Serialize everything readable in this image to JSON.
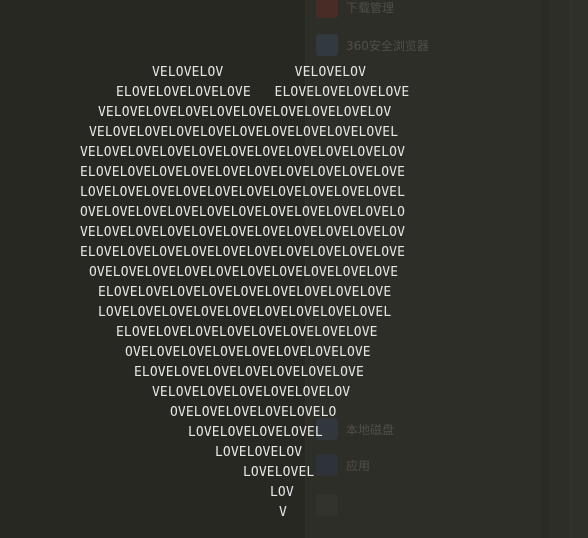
{
  "terminal": {
    "top_fragment": "  ''        '' ",
    "heart_lines": [
      "VELOVELOV         VELOVELOV",
      "ELOVELOVELOVELOVE   ELOVELOVELOVELOVE",
      "VELOVELOVELOVELOVELOVELOVELOVELOVELOV",
      "VELOVELOVELOVELOVELOVELOVELOVELOVELOVEL",
      "VELOVELOVELOVELOVELOVELOVELOVELOVELOVELOV",
      "ELOVELOVELOVELOVELOVELOVELOVELOVELOVELOVE",
      "LOVELOVELOVELOVELOVELOVELOVELOVELOVELOVEL",
      "OVELOVELOVELOVELOVELOVELOVELOVELOVELOVELO",
      "VELOVELOVELOVELOVELOVELOVELOVELOVELOVELOV",
      "ELOVELOVELOVELOVELOVELOVELOVELOVELOVELOVE",
      "OVELOVELOVELOVELOVELOVELOVELOVELOVELOVE",
      "ELOVELOVELOVELOVELOVELOVELOVELOVELOVE",
      "LOVELOVELOVELOVELOVELOVELOVELOVELOVEL",
      "ELOVELOVELOVELOVELOVELOVELOVELOVE",
      "OVELOVELOVELOVELOVELOVELOVELOVE",
      "ELOVELOVELOVELOVELOVELOVELOVE",
      "VELOVELOVELOVELOVELOVELOV",
      "OVELOVELOVELOVELOVELO",
      "LOVELOVELOVELOVEL",
      "LOVELOVELOV",
      "LOVELOVEL",
      "LOV",
      "V"
    ]
  },
  "background": {
    "items": [
      {
        "icon": "red-square-icon",
        "color": "#c0392b",
        "label": "下载管理"
      },
      {
        "icon": "cloud-icon",
        "color": "#4a6fa5",
        "label": "360安全浏览器"
      },
      {
        "icon": "doc-icon",
        "color": "#7a7a6a",
        "label": ""
      },
      {
        "icon": "folder-icon",
        "color": "#556b8e",
        "label": "本地磁盘"
      },
      {
        "icon": "app-icon",
        "color": "#3f5f8f",
        "label": "应用"
      }
    ]
  }
}
